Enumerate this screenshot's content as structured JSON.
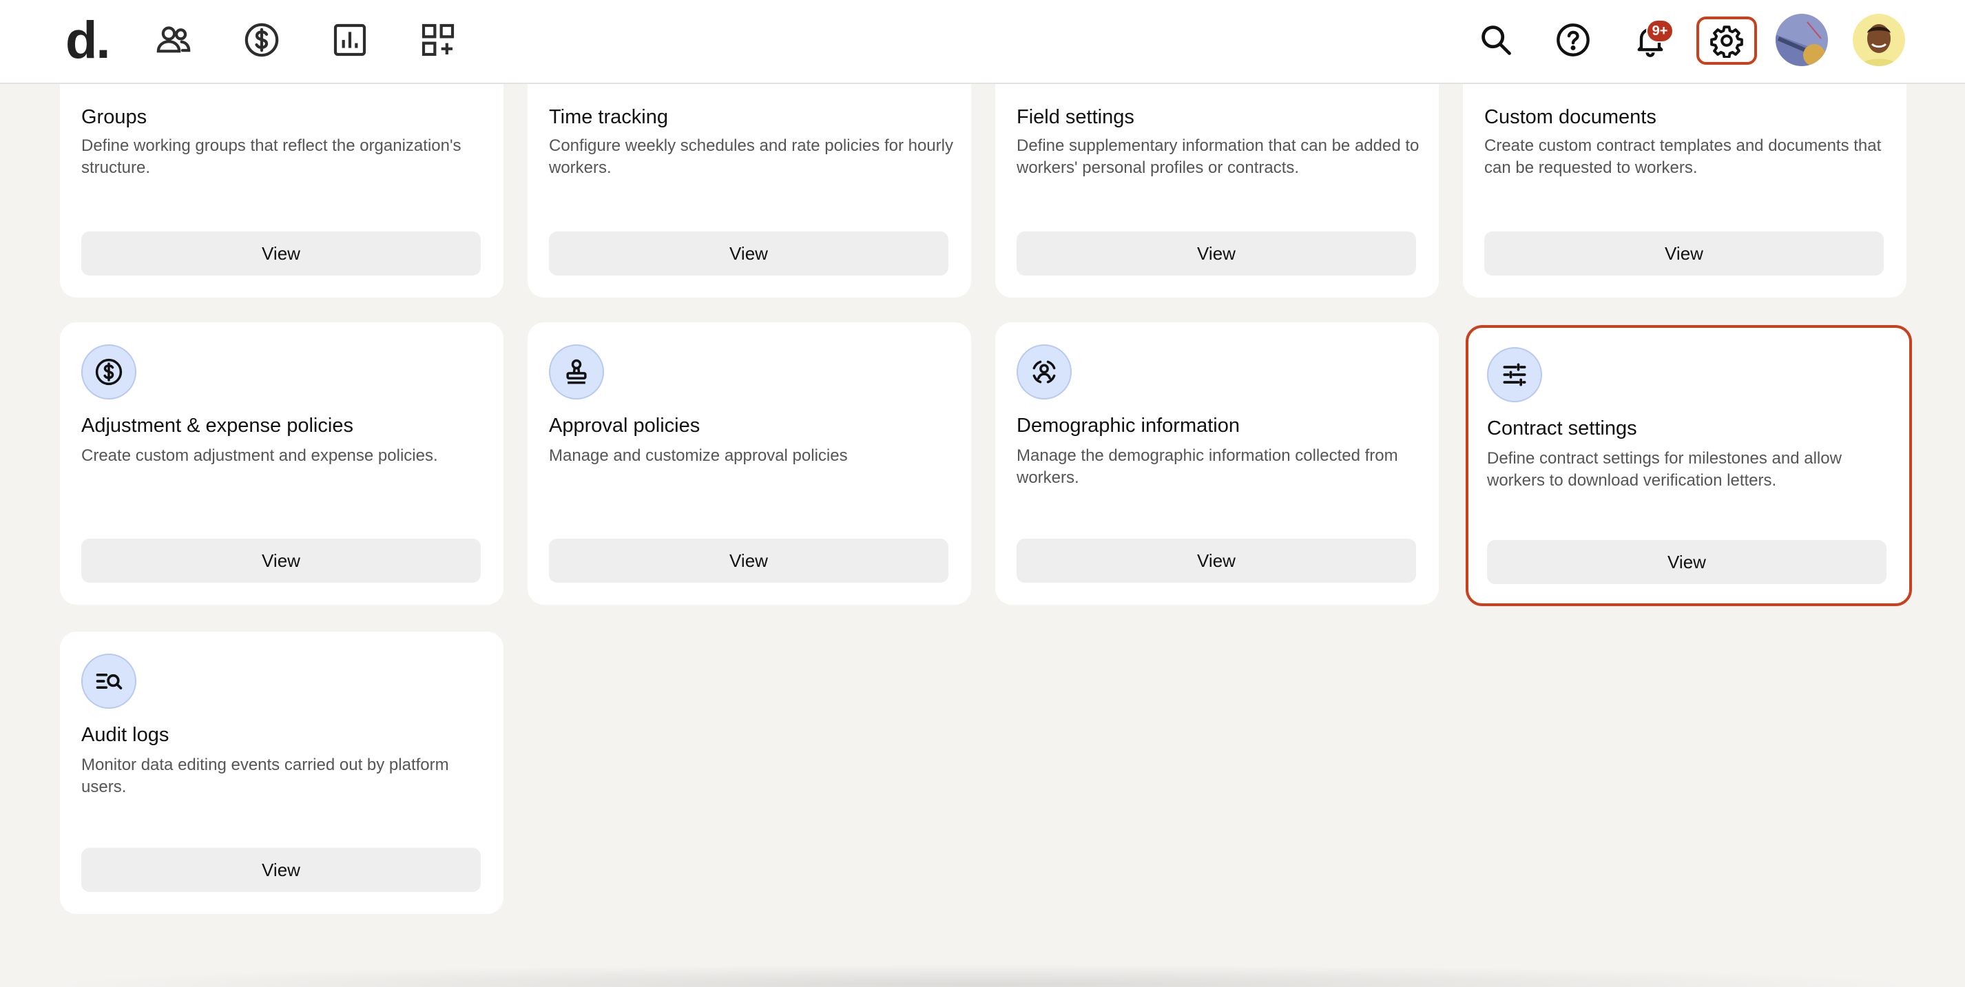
{
  "header": {
    "logo": "d.",
    "notification_count": "9+"
  },
  "nav_icons": [
    "people-icon",
    "dollar-icon",
    "chart-icon",
    "apps-add-icon"
  ],
  "right_icons": [
    "search-icon",
    "help-icon",
    "bell-icon",
    "gear-icon"
  ],
  "colors": {
    "accent": "#c8401c",
    "icon_bg": "#d8e4fb",
    "badge": "#b7321f",
    "page_bg": "#f4f3f0"
  },
  "cards": [
    {
      "title": "Groups",
      "description": "Define working groups that reflect the organization's structure.",
      "button": "View"
    },
    {
      "title": "Time tracking",
      "description": "Configure weekly schedules and rate policies for hourly workers.",
      "button": "View"
    },
    {
      "title": "Field settings",
      "description": "Define supplementary information that can be added to workers' personal profiles or contracts.",
      "button": "View"
    },
    {
      "title": "Custom documents",
      "description": "Create custom contract templates and documents that can be requested to workers.",
      "button": "View"
    },
    {
      "title": "Adjustment & expense policies",
      "description": "Create custom adjustment and expense policies.",
      "button": "View",
      "icon": "dollar-circle-icon"
    },
    {
      "title": "Approval policies",
      "description": "Manage and customize approval policies",
      "button": "View",
      "icon": "stamp-icon"
    },
    {
      "title": "Demographic information",
      "description": "Manage the demographic information collected from workers.",
      "button": "View",
      "icon": "person-scan-icon"
    },
    {
      "title": "Contract settings",
      "description": "Define contract settings for milestones and allow workers to download verification letters.",
      "button": "View",
      "icon": "sliders-icon"
    },
    {
      "title": "Audit logs",
      "description": "Monitor data editing events carried out by platform users.",
      "button": "View",
      "icon": "search-list-icon"
    }
  ]
}
